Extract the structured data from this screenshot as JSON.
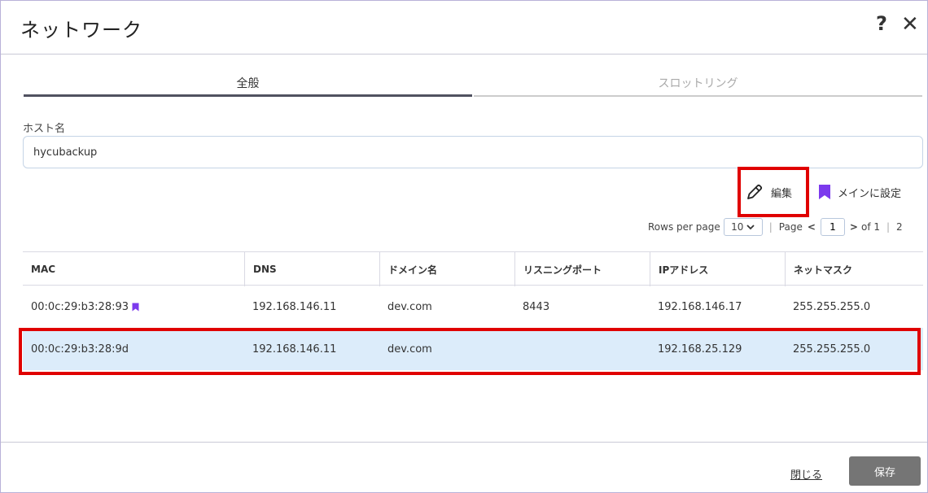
{
  "dialog": {
    "title": "ネットワーク",
    "help_label": "?",
    "close_label": "✕"
  },
  "tabs": [
    {
      "label": "全般",
      "active": true
    },
    {
      "label": "スロットリング",
      "active": false
    }
  ],
  "host": {
    "label": "ホスト名",
    "value": "hycubackup"
  },
  "actions": {
    "edit_label": "編集",
    "set_main_label": "メインに設定",
    "accent_color": "#7c3aed",
    "highlight_color": "#e00000"
  },
  "pager": {
    "rows_per_page_label": "Rows per page",
    "rows_per_page_value": "10",
    "page_label": "Page",
    "current_page": "1",
    "of_label": "of 1",
    "total": "2"
  },
  "table": {
    "columns": [
      "MAC",
      "DNS",
      "ドメイン名",
      "リスニングポート",
      "IPアドレス",
      "ネットマスク"
    ],
    "rows": [
      {
        "mac": "00:0c:29:b3:28:93",
        "is_main": true,
        "dns": "192.168.146.11",
        "domain": "dev.com",
        "port": "8443",
        "ip": "192.168.146.17",
        "netmask": "255.255.255.0"
      },
      {
        "mac": "00:0c:29:b3:28:9d",
        "is_main": false,
        "dns": "192.168.146.11",
        "domain": "dev.com",
        "port": "",
        "ip": "192.168.25.129",
        "netmask": "255.255.255.0"
      }
    ]
  },
  "footer": {
    "close_label": "閉じる",
    "save_label": "保存"
  }
}
